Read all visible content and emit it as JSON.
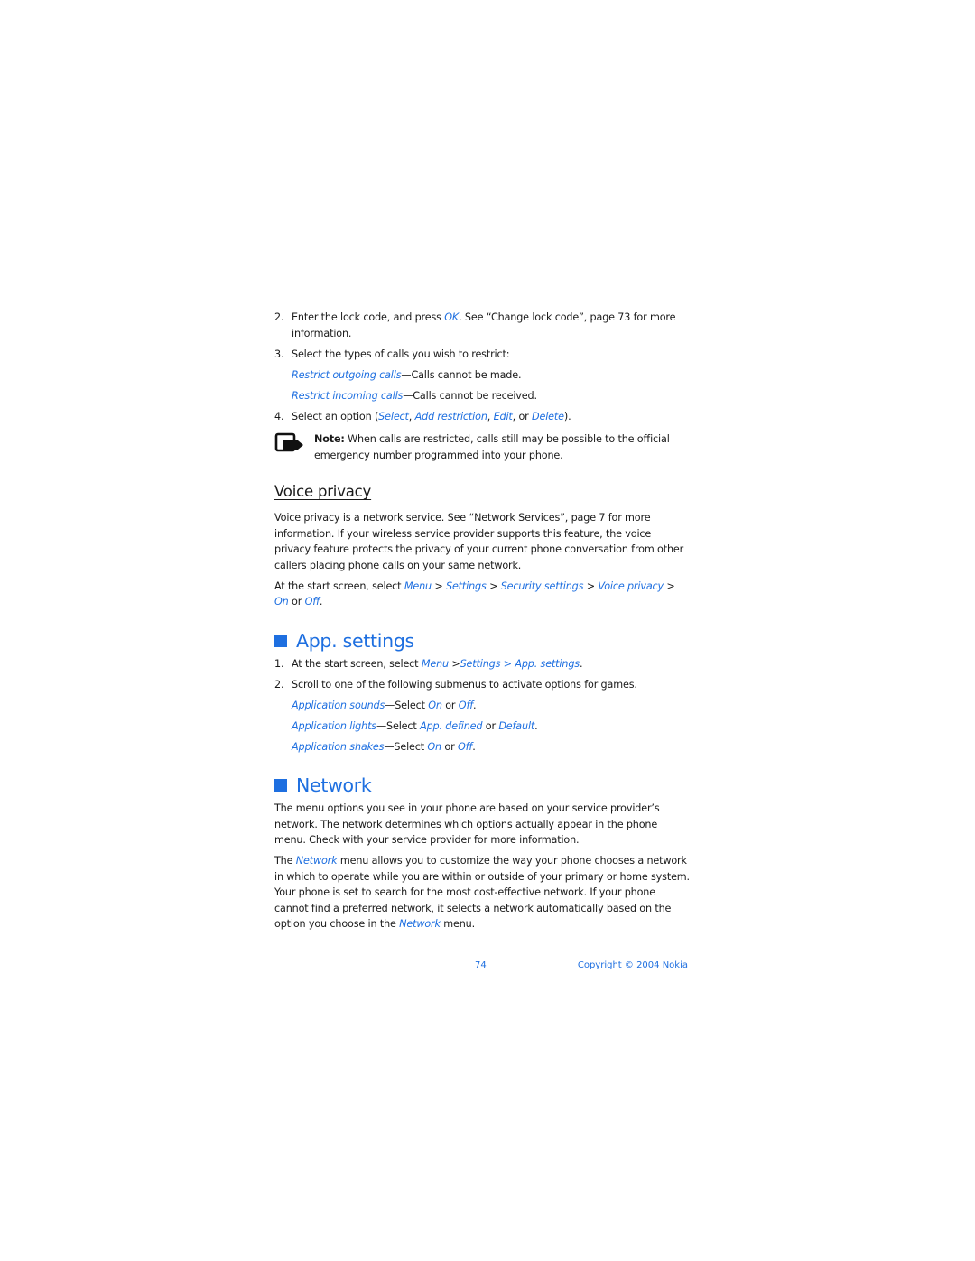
{
  "steps_top": [
    {
      "num": "2.",
      "parts": {
        "a": "Enter the lock code, and press ",
        "ok": "OK",
        "b": ". See “Change lock code”, page 73 for more information."
      }
    },
    {
      "num": "3.",
      "text": "Select the types of calls you wish to restrict:"
    }
  ],
  "restrict_options": [
    {
      "label": "Restrict outgoing calls",
      "desc": "—Calls cannot be made."
    },
    {
      "label": "Restrict incoming calls",
      "desc": "—Calls cannot be received."
    }
  ],
  "step4": {
    "num": "4.",
    "a": "Select an option (",
    "opt1": "Select",
    "sep1": ", ",
    "opt2": "Add restriction",
    "sep2": ", ",
    "opt3": "Edit",
    "sep3": ", or ",
    "opt4": "Delete",
    "end": ")."
  },
  "note": {
    "icon": "note-hand-icon",
    "label": "Note:",
    "text": " When calls are restricted, calls still may be possible to the official emergency number programmed into your phone."
  },
  "voice_privacy": {
    "title": "Voice privacy",
    "body": "Voice privacy is a network service. See “Network Services”, page 7 for more information. If your wireless service provider supports this feature, the voice privacy feature protects the privacy of your current phone conversation from other callers placing phone calls on your same network.",
    "path": {
      "a": "At the start screen, select ",
      "menu": "Menu",
      "gt1": " > ",
      "settings": "Settings",
      "gt2": " > ",
      "security": "Security settings",
      "gt3": " > ",
      "voice": "Voice privacy",
      "gt4": " > ",
      "on": "On",
      "or": " or ",
      "off": "Off",
      "end": "."
    }
  },
  "app_settings": {
    "title": "App. settings",
    "step1": {
      "num": "1.",
      "a": "At the start screen, select ",
      "menu": "Menu",
      "gt1": " >",
      "settings": "Settings > App. settings",
      "end": "."
    },
    "step2": {
      "num": "2.",
      "text": "Scroll to one of the following submenus to activate options for games."
    },
    "options": [
      {
        "label": "Application sounds",
        "mid": "—Select ",
        "v1": "On",
        "or": " or ",
        "v2": "Off",
        "end": "."
      },
      {
        "label": "Application lights",
        "mid": "—Select ",
        "v1": "App. defined",
        "or": " or ",
        "v2": "Default",
        "end": "."
      },
      {
        "label": "Application shakes",
        "mid": "—Select ",
        "v1": "On",
        "or": " or ",
        "v2": "Off",
        "end": "."
      }
    ]
  },
  "network": {
    "title": "Network",
    "para1": "The menu options you see in your phone are based on your service provider’s network. The network determines which options actually appear in the phone menu. Check with your service provider for more information.",
    "para2": {
      "a": "The ",
      "link1": "Network",
      "b": " menu allows you to customize the way your phone chooses a network in which to operate while you are within or outside of your primary or home system. Your phone is set to search for the most cost-effective network. If your phone cannot find a preferred network, it selects a network automatically based on the option you choose in the ",
      "link2": "Network",
      "c": " menu."
    }
  },
  "footer": {
    "page_number": "74",
    "copyright": "Copyright © 2004 Nokia"
  },
  "colors": {
    "accent": "#1e6fe0",
    "text": "#1a1a1a"
  }
}
